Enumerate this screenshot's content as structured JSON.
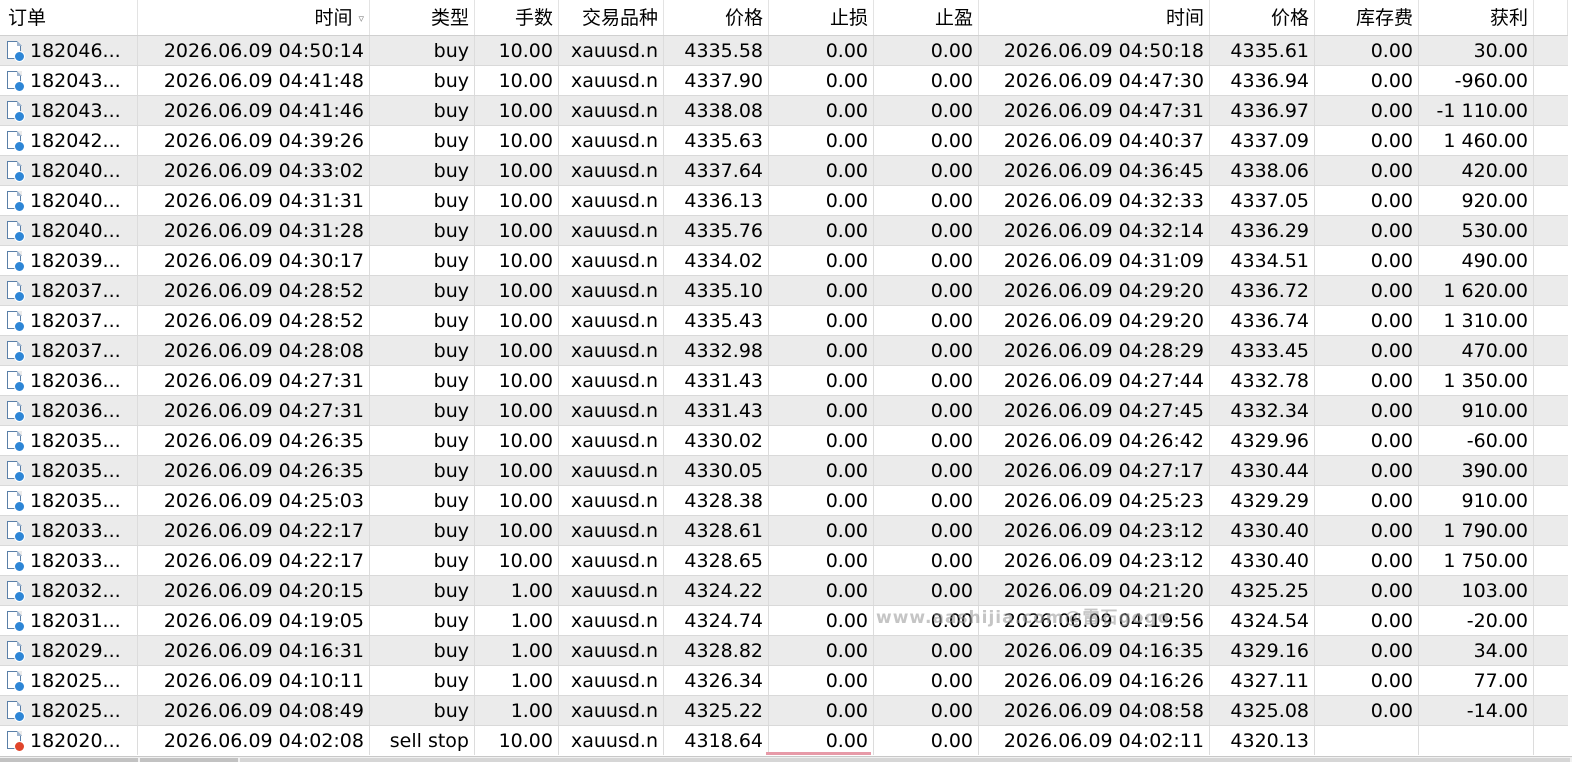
{
  "columns": {
    "order": "订单",
    "open_time": "时间",
    "sort_indicator": "▿",
    "type": "类型",
    "lots": "手数",
    "symbol": "交易品种",
    "open_price": "价格",
    "stop_loss": "止损",
    "take_profit": "止盈",
    "close_time": "时间",
    "close_price": "价格",
    "swap": "库存费",
    "profit": "获利"
  },
  "rows": [
    {
      "order": "182046...",
      "open_time": "2026.06.09 04:50:14",
      "type": "buy",
      "lots": "10.00",
      "symbol": "xauusd.n",
      "open_price": "4335.58",
      "stop_loss": "0.00",
      "take_profit": "0.00",
      "close_time": "2026.06.09 04:50:18",
      "close_price": "4335.61",
      "swap": "0.00",
      "profit": "30.00",
      "status": "closed"
    },
    {
      "order": "182043...",
      "open_time": "2026.06.09 04:41:48",
      "type": "buy",
      "lots": "10.00",
      "symbol": "xauusd.n",
      "open_price": "4337.90",
      "stop_loss": "0.00",
      "take_profit": "0.00",
      "close_time": "2026.06.09 04:47:30",
      "close_price": "4336.94",
      "swap": "0.00",
      "profit": "-960.00",
      "status": "closed"
    },
    {
      "order": "182043...",
      "open_time": "2026.06.09 04:41:46",
      "type": "buy",
      "lots": "10.00",
      "symbol": "xauusd.n",
      "open_price": "4338.08",
      "stop_loss": "0.00",
      "take_profit": "0.00",
      "close_time": "2026.06.09 04:47:31",
      "close_price": "4336.97",
      "swap": "0.00",
      "profit": "-1 110.00",
      "status": "closed"
    },
    {
      "order": "182042...",
      "open_time": "2026.06.09 04:39:26",
      "type": "buy",
      "lots": "10.00",
      "symbol": "xauusd.n",
      "open_price": "4335.63",
      "stop_loss": "0.00",
      "take_profit": "0.00",
      "close_time": "2026.06.09 04:40:37",
      "close_price": "4337.09",
      "swap": "0.00",
      "profit": "1 460.00",
      "status": "closed"
    },
    {
      "order": "182040...",
      "open_time": "2026.06.09 04:33:02",
      "type": "buy",
      "lots": "10.00",
      "symbol": "xauusd.n",
      "open_price": "4337.64",
      "stop_loss": "0.00",
      "take_profit": "0.00",
      "close_time": "2026.06.09 04:36:45",
      "close_price": "4338.06",
      "swap": "0.00",
      "profit": "420.00",
      "status": "closed"
    },
    {
      "order": "182040...",
      "open_time": "2026.06.09 04:31:31",
      "type": "buy",
      "lots": "10.00",
      "symbol": "xauusd.n",
      "open_price": "4336.13",
      "stop_loss": "0.00",
      "take_profit": "0.00",
      "close_time": "2026.06.09 04:32:33",
      "close_price": "4337.05",
      "swap": "0.00",
      "profit": "920.00",
      "status": "closed"
    },
    {
      "order": "182040...",
      "open_time": "2026.06.09 04:31:28",
      "type": "buy",
      "lots": "10.00",
      "symbol": "xauusd.n",
      "open_price": "4335.76",
      "stop_loss": "0.00",
      "take_profit": "0.00",
      "close_time": "2026.06.09 04:32:14",
      "close_price": "4336.29",
      "swap": "0.00",
      "profit": "530.00",
      "status": "closed"
    },
    {
      "order": "182039...",
      "open_time": "2026.06.09 04:30:17",
      "type": "buy",
      "lots": "10.00",
      "symbol": "xauusd.n",
      "open_price": "4334.02",
      "stop_loss": "0.00",
      "take_profit": "0.00",
      "close_time": "2026.06.09 04:31:09",
      "close_price": "4334.51",
      "swap": "0.00",
      "profit": "490.00",
      "status": "closed"
    },
    {
      "order": "182037...",
      "open_time": "2026.06.09 04:28:52",
      "type": "buy",
      "lots": "10.00",
      "symbol": "xauusd.n",
      "open_price": "4335.10",
      "stop_loss": "0.00",
      "take_profit": "0.00",
      "close_time": "2026.06.09 04:29:20",
      "close_price": "4336.72",
      "swap": "0.00",
      "profit": "1 620.00",
      "status": "closed"
    },
    {
      "order": "182037...",
      "open_time": "2026.06.09 04:28:52",
      "type": "buy",
      "lots": "10.00",
      "symbol": "xauusd.n",
      "open_price": "4335.43",
      "stop_loss": "0.00",
      "take_profit": "0.00",
      "close_time": "2026.06.09 04:29:20",
      "close_price": "4336.74",
      "swap": "0.00",
      "profit": "1 310.00",
      "status": "closed"
    },
    {
      "order": "182037...",
      "open_time": "2026.06.09 04:28:08",
      "type": "buy",
      "lots": "10.00",
      "symbol": "xauusd.n",
      "open_price": "4332.98",
      "stop_loss": "0.00",
      "take_profit": "0.00",
      "close_time": "2026.06.09 04:28:29",
      "close_price": "4333.45",
      "swap": "0.00",
      "profit": "470.00",
      "status": "closed"
    },
    {
      "order": "182036...",
      "open_time": "2026.06.09 04:27:31",
      "type": "buy",
      "lots": "10.00",
      "symbol": "xauusd.n",
      "open_price": "4331.43",
      "stop_loss": "0.00",
      "take_profit": "0.00",
      "close_time": "2026.06.09 04:27:44",
      "close_price": "4332.78",
      "swap": "0.00",
      "profit": "1 350.00",
      "status": "closed"
    },
    {
      "order": "182036...",
      "open_time": "2026.06.09 04:27:31",
      "type": "buy",
      "lots": "10.00",
      "symbol": "xauusd.n",
      "open_price": "4331.43",
      "stop_loss": "0.00",
      "take_profit": "0.00",
      "close_time": "2026.06.09 04:27:45",
      "close_price": "4332.34",
      "swap": "0.00",
      "profit": "910.00",
      "status": "closed"
    },
    {
      "order": "182035...",
      "open_time": "2026.06.09 04:26:35",
      "type": "buy",
      "lots": "10.00",
      "symbol": "xauusd.n",
      "open_price": "4330.02",
      "stop_loss": "0.00",
      "take_profit": "0.00",
      "close_time": "2026.06.09 04:26:42",
      "close_price": "4329.96",
      "swap": "0.00",
      "profit": "-60.00",
      "status": "closed"
    },
    {
      "order": "182035...",
      "open_time": "2026.06.09 04:26:35",
      "type": "buy",
      "lots": "10.00",
      "symbol": "xauusd.n",
      "open_price": "4330.05",
      "stop_loss": "0.00",
      "take_profit": "0.00",
      "close_time": "2026.06.09 04:27:17",
      "close_price": "4330.44",
      "swap": "0.00",
      "profit": "390.00",
      "status": "closed"
    },
    {
      "order": "182035...",
      "open_time": "2026.06.09 04:25:03",
      "type": "buy",
      "lots": "10.00",
      "symbol": "xauusd.n",
      "open_price": "4328.38",
      "stop_loss": "0.00",
      "take_profit": "0.00",
      "close_time": "2026.06.09 04:25:23",
      "close_price": "4329.29",
      "swap": "0.00",
      "profit": "910.00",
      "status": "closed"
    },
    {
      "order": "182033...",
      "open_time": "2026.06.09 04:22:17",
      "type": "buy",
      "lots": "10.00",
      "symbol": "xauusd.n",
      "open_price": "4328.61",
      "stop_loss": "0.00",
      "take_profit": "0.00",
      "close_time": "2026.06.09 04:23:12",
      "close_price": "4330.40",
      "swap": "0.00",
      "profit": "1 790.00",
      "status": "closed"
    },
    {
      "order": "182033...",
      "open_time": "2026.06.09 04:22:17",
      "type": "buy",
      "lots": "10.00",
      "symbol": "xauusd.n",
      "open_price": "4328.65",
      "stop_loss": "0.00",
      "take_profit": "0.00",
      "close_time": "2026.06.09 04:23:12",
      "close_price": "4330.40",
      "swap": "0.00",
      "profit": "1 750.00",
      "status": "closed"
    },
    {
      "order": "182032...",
      "open_time": "2026.06.09 04:20:15",
      "type": "buy",
      "lots": "1.00",
      "symbol": "xauusd.n",
      "open_price": "4324.22",
      "stop_loss": "0.00",
      "take_profit": "0.00",
      "close_time": "2026.06.09 04:21:20",
      "close_price": "4325.25",
      "swap": "0.00",
      "profit": "103.00",
      "status": "closed"
    },
    {
      "order": "182031...",
      "open_time": "2026.06.09 04:19:05",
      "type": "buy",
      "lots": "1.00",
      "symbol": "xauusd.n",
      "open_price": "4324.74",
      "stop_loss": "0.00",
      "take_profit": "0.00",
      "close_time": "2026.06.09 04:19:56",
      "close_price": "4324.54",
      "swap": "0.00",
      "profit": "-20.00",
      "status": "closed"
    },
    {
      "order": "182029...",
      "open_time": "2026.06.09 04:16:31",
      "type": "buy",
      "lots": "1.00",
      "symbol": "xauusd.n",
      "open_price": "4328.82",
      "stop_loss": "0.00",
      "take_profit": "0.00",
      "close_time": "2026.06.09 04:16:35",
      "close_price": "4329.16",
      "swap": "0.00",
      "profit": "34.00",
      "status": "closed"
    },
    {
      "order": "182025...",
      "open_time": "2026.06.09 04:10:11",
      "type": "buy",
      "lots": "1.00",
      "symbol": "xauusd.n",
      "open_price": "4326.34",
      "stop_loss": "0.00",
      "take_profit": "0.00",
      "close_time": "2026.06.09 04:16:26",
      "close_price": "4327.11",
      "swap": "0.00",
      "profit": "77.00",
      "status": "closed"
    },
    {
      "order": "182025...",
      "open_time": "2026.06.09 04:08:49",
      "type": "buy",
      "lots": "1.00",
      "symbol": "xauusd.n",
      "open_price": "4325.22",
      "stop_loss": "0.00",
      "take_profit": "0.00",
      "close_time": "2026.06.09 04:08:58",
      "close_price": "4325.08",
      "swap": "0.00",
      "profit": "-14.00",
      "status": "closed"
    },
    {
      "order": "182020...",
      "open_time": "2026.06.09 04:02:08",
      "type": "sell stop",
      "lots": "10.00",
      "symbol": "xauusd.n",
      "open_price": "4318.64",
      "stop_loss": "0.00",
      "take_profit": "0.00",
      "close_time": "2026.06.09 04:02:11",
      "close_price": "4320.13",
      "swap": "",
      "profit": "",
      "status": "cancelled"
    }
  ],
  "icons": {
    "closed": "order-closed-icon",
    "cancelled": "order-cancelled-icon"
  },
  "colors": {
    "closed_dot": "#2e86d6",
    "cancelled_dot": "#e0452b",
    "row_alt": "#ebebeb"
  },
  "watermark": "www.aashijia.com@雷石gogo"
}
